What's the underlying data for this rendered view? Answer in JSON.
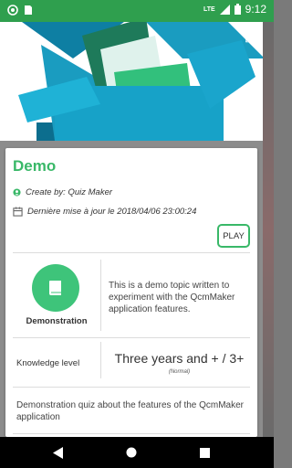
{
  "status_bar": {
    "network": "LTE",
    "time": "9:12"
  },
  "topic": {
    "title": "Demo",
    "author": "Create by: Quiz Maker",
    "updated": "Dernière mise à jour le 2018/04/06 23:00:24",
    "play_label": "PLAY",
    "name": "Demonstration",
    "description": "This is a demo topic written to experiment with the QcmMaker application features.",
    "knowledge_label": "Knowledge level",
    "knowledge_value": "Three years and + / 3+",
    "knowledge_note": "(Normal)",
    "quiz_description": "Demonstration quiz about the features of the QcmMaker application"
  },
  "colors": {
    "status_bar": "#2f9f4e",
    "accent": "#39b868",
    "topic_icon": "#3ec47a",
    "box_teal": "#1a9cc0"
  },
  "icons": {
    "expand": "expand-icon",
    "author": "person-circle-icon",
    "date": "calendar-icon",
    "topic": "book-icon",
    "back": "back-triangle-icon",
    "home": "home-circle-icon",
    "recent": "recents-square-icon"
  }
}
